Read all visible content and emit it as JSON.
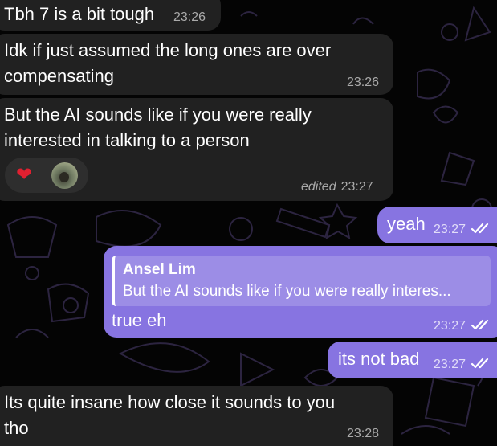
{
  "colors": {
    "incoming_bubble": "#212121",
    "outgoing_bubble": "#8774e1",
    "reaction_pill": "#2e2e2e",
    "background": "#040404",
    "doodle": "#2c2440"
  },
  "messages": [
    {
      "direction": "incoming",
      "text": "Tbh 7 is a bit tough",
      "time": "23:26"
    },
    {
      "direction": "incoming",
      "lines": [
        "Idk if just assumed the long ones are over",
        "compensating"
      ],
      "time": "23:26"
    },
    {
      "direction": "incoming",
      "lines": [
        "But the AI sounds like if you were really",
        "interested in talking to a person"
      ],
      "edited_label": "edited",
      "time": "23:27",
      "reactions": [
        {
          "icon": "heart-icon",
          "glyph": "❤"
        },
        {
          "icon": "avatar-icon"
        }
      ]
    },
    {
      "direction": "outgoing",
      "text": "yeah",
      "time": "23:27",
      "status_icon": "double-check-icon"
    },
    {
      "direction": "outgoing",
      "reply_to": {
        "name": "Ansel Lim",
        "text": "But the AI sounds like if you were really interes..."
      },
      "text": "true eh",
      "time": "23:27",
      "status_icon": "double-check-icon"
    },
    {
      "direction": "outgoing",
      "text": "its not bad",
      "time": "23:27",
      "status_icon": "double-check-icon"
    },
    {
      "direction": "incoming",
      "lines": [
        "Its quite insane how close it sounds to you",
        "tho"
      ],
      "time": "23:28"
    }
  ]
}
